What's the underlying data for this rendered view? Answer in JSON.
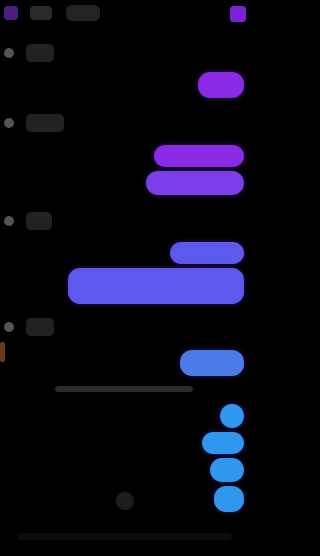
{
  "topbar": {},
  "sections": [],
  "messages": [],
  "colors": {
    "background": "#000000",
    "purple_primary": "#8a2ae7",
    "purple_secondary": "#7c3ee8",
    "blue_1": "#5d58ee",
    "blue_2": "#4a7be9",
    "blue_3": "#2f97ee"
  },
  "icons": [
    "menu-icon",
    "search-icon",
    "more-icon"
  ]
}
